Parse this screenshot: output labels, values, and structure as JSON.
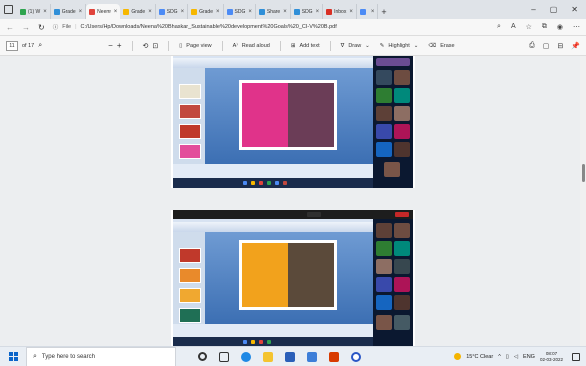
{
  "browser": {
    "tabs": [
      {
        "label": "(1) W",
        "color": "#2ea44f"
      },
      {
        "label": "Grade",
        "color": "#2f8fd8"
      },
      {
        "label": "Neerɐ",
        "color": "#e0433b",
        "active": true
      },
      {
        "label": "Grade",
        "color": "#f6b700"
      },
      {
        "label": "SDG",
        "color": "#4c8bf5"
      },
      {
        "label": "Grade",
        "color": "#f6b700"
      },
      {
        "label": "SDG",
        "color": "#4c8bf5"
      },
      {
        "label": "Share",
        "color": "#2f8fd8"
      },
      {
        "label": "SDG",
        "color": "#2f8fd8"
      },
      {
        "label": "Inbox",
        "color": "#d93025"
      },
      {
        "label": "",
        "color": "#4c8bf5"
      }
    ],
    "new_tab": "+",
    "address": {
      "scheme_label": "File",
      "url": "C:/Users/Hp/Downloads/Neena%20Bhaskar_Sustainable%20development%20Goals%20_CI-V%20B.pdf"
    }
  },
  "pdf_toolbar": {
    "page_current": "11",
    "page_total": "of 17",
    "page_view": "Page view",
    "read_aloud": "Read aloud",
    "add_text": "Add text",
    "draw": "Draw",
    "highlight": "Highlight",
    "erase": "Erase"
  },
  "taskbar": {
    "search_placeholder": "Type here to search",
    "weather": "15°C Clear",
    "lang": "ENG",
    "time": "08:07",
    "date": "02-03-2022"
  }
}
